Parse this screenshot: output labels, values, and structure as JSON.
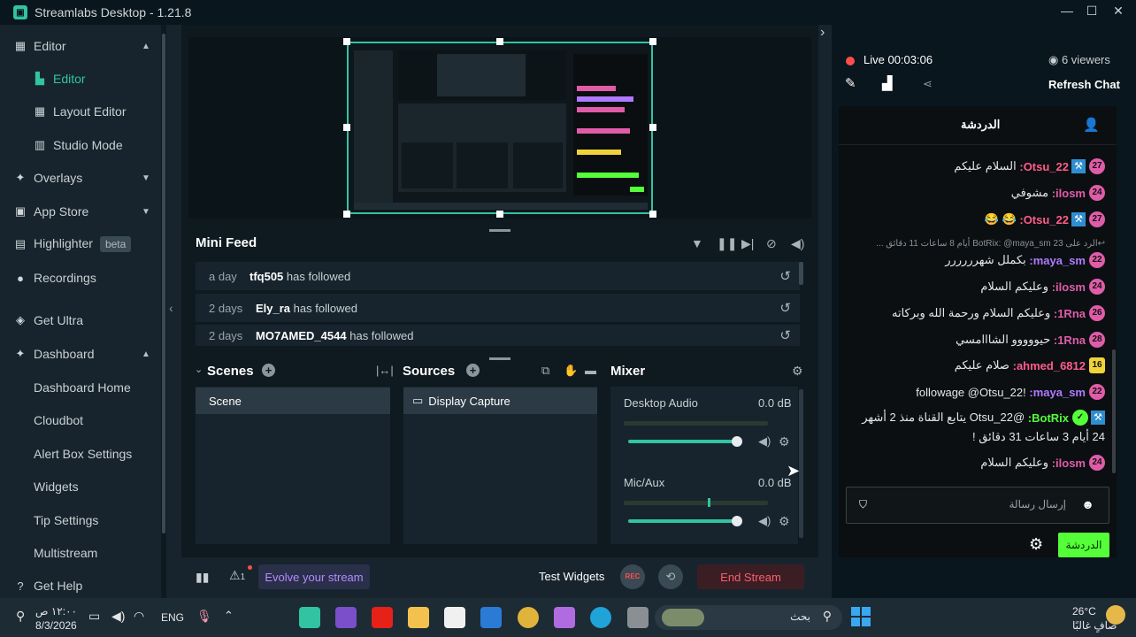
{
  "titlebar": {
    "title": "Streamlabs Desktop - 1.21.8",
    "minimize": "—",
    "maximize": "☐",
    "close": "✕"
  },
  "sidebar": {
    "items": [
      {
        "label": "Editor",
        "icon": "editor-icon",
        "chevron": "▲"
      },
      {
        "label": "Editor",
        "icon": "editor-sub-icon"
      },
      {
        "label": "Layout Editor",
        "icon": "layout-icon"
      },
      {
        "label": "Studio Mode",
        "icon": "studio-icon"
      },
      {
        "label": "Overlays",
        "icon": "overlays-icon",
        "chevron": "▼"
      },
      {
        "label": "App Store",
        "icon": "store-icon",
        "chevron": "▼"
      },
      {
        "label": "Highlighter",
        "icon": "highlighter-icon",
        "badge": "beta"
      },
      {
        "label": "Recordings",
        "icon": "recordings-icon"
      },
      {
        "label": "Get Ultra",
        "icon": "ultra-icon"
      },
      {
        "label": "Dashboard",
        "icon": "dashboard-icon",
        "chevron": "▲"
      },
      {
        "label": "Dashboard Home"
      },
      {
        "label": "Cloudbot"
      },
      {
        "label": "Alert Box Settings"
      },
      {
        "label": "Widgets"
      },
      {
        "label": "Tip Settings"
      },
      {
        "label": "Multistream"
      },
      {
        "label": "Get Help",
        "icon": "help-icon"
      }
    ],
    "collapse": "‹"
  },
  "mini_feed": {
    "title": "Mini Feed",
    "rows": [
      {
        "time": "a day",
        "name": "tfq505",
        "action": "has followed"
      },
      {
        "time": "2 days",
        "name": "Ely_ra",
        "action": "has followed"
      },
      {
        "time": "2 days",
        "name": "MO7AMED_4544",
        "action": "has followed"
      }
    ],
    "refresh": "↺"
  },
  "scenes": {
    "title": "Scenes",
    "items": [
      "Scene"
    ]
  },
  "sources": {
    "title": "Sources",
    "items": [
      "Display Capture"
    ]
  },
  "mixer": {
    "title": "Mixer",
    "channels": [
      {
        "name": "Desktop Audio",
        "level": "0.0 dB",
        "volume": 0.95
      },
      {
        "name": "Mic/Aux",
        "level": "0.0 dB",
        "volume": 0.95
      }
    ]
  },
  "footer": {
    "warning_count": "1",
    "evolve": "Evolve your stream",
    "test_widgets": "Test Widgets",
    "rec": "REC",
    "end_stream": "End Stream"
  },
  "stream": {
    "status": "Live 00:03:06",
    "viewers": "6 viewers",
    "refresh_chat": "Refresh Chat"
  },
  "chat": {
    "tab": "الدردشة",
    "messages": [
      {
        "badge": "27",
        "badge_color": "pink",
        "mod": true,
        "user": "Otsu_22",
        "user_color": "#ff5c8a",
        "text": "السلام عليكم"
      },
      {
        "badge": "24",
        "badge_color": "pink",
        "mod": false,
        "user": "ilosm",
        "user_color": "#e05ca8",
        "text": "مشوفي"
      },
      {
        "badge": "27",
        "badge_color": "pink",
        "mod": true,
        "user": "Otsu_22",
        "user_color": "#ff5c8a",
        "text": "😂 😂"
      },
      {
        "reply": "الرد على BotRix: @maya_sm 23 أيام 8 ساعات 11 دقائق ..."
      },
      {
        "badge": "22",
        "badge_color": "pink",
        "mod": false,
        "user": "maya_sm",
        "user_color": "#b07aff",
        "text": "بكملل شهرررررر"
      },
      {
        "badge": "24",
        "badge_color": "pink",
        "mod": false,
        "user": "ilosm",
        "user_color": "#e05ca8",
        "text": "وعليكم السلام"
      },
      {
        "badge": "26",
        "badge_color": "pink",
        "mod": false,
        "user": "1Rna",
        "user_color": "#e05ca8",
        "text": "وعليكم السلام ورحمة الله وبركاته"
      },
      {
        "badge": "28",
        "badge_color": "pink",
        "mod": false,
        "user": "1Rna",
        "user_color": "#e05ca8",
        "text": "حيووووو الشااامسي"
      },
      {
        "badge": "16",
        "badge_color": "yellow",
        "mod": false,
        "user": "ahmed_6812",
        "user_color": "#ff5c8a",
        "text": "صلام عليكم"
      },
      {
        "badge": "22",
        "badge_color": "pink",
        "mod": false,
        "user": "maya_sm",
        "user_color": "#b07aff",
        "text": "!followage @Otsu_22"
      },
      {
        "badge": "",
        "badge_color": "",
        "mod": true,
        "user": "BotRix",
        "user_color": "#54ff3a",
        "text": "@Otsu_22 يتابع القناة منذ 2 أشهر"
      },
      {
        "continuation": "24 أيام 3 ساعات 31 دقائق !"
      },
      {
        "badge": "24",
        "badge_color": "pink",
        "mod": false,
        "user": "ilosm",
        "user_color": "#e05ca8",
        "text": "وعليكم السلام"
      }
    ],
    "input_placeholder": "إرسال رسالة",
    "send": "الدردشة"
  },
  "taskbar": {
    "time": "١٢:٠٠ ص",
    "date": "8/3/2026",
    "lang": "ENG",
    "search": "بحث",
    "weather_temp": "26°C",
    "weather_desc": "صافٍ غالبًا"
  }
}
